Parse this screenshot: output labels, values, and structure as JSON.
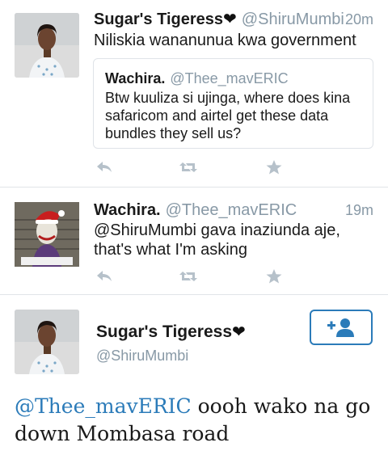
{
  "tweets": [
    {
      "author_name": "Sugar's Tigeress",
      "author_handle": "@ShiruMumbi",
      "time": "20m",
      "text": "Niliskia wananunua kwa government",
      "quoted": {
        "author_name": "Wachira.",
        "author_handle": "@Thee_mavERIC",
        "text": "Btw kuuliza si ujinga, where does kina safaricom and airtel get these data bundles they sell us?"
      }
    },
    {
      "author_name": "Wachira.",
      "author_handle": "@Thee_mavERIC",
      "time": "19m",
      "text": "@ShiruMumbi gava inaziunda aje, that's what I'm asking"
    }
  ],
  "detail": {
    "author_name": "Sugar's Tigeress",
    "author_handle": "@ShiruMumbi",
    "mention": "@Thee_mavERIC",
    "text": " oooh wako na go down Mombasa road"
  },
  "icons": {
    "reply": "reply-icon",
    "retweet": "retweet-icon",
    "favorite": "star-icon",
    "follow": "add-user-icon",
    "heart": "heart-emoji"
  },
  "colors": {
    "accent": "#2b7bb9",
    "muted": "#8899a6",
    "action_icon": "#b6c1ca"
  }
}
